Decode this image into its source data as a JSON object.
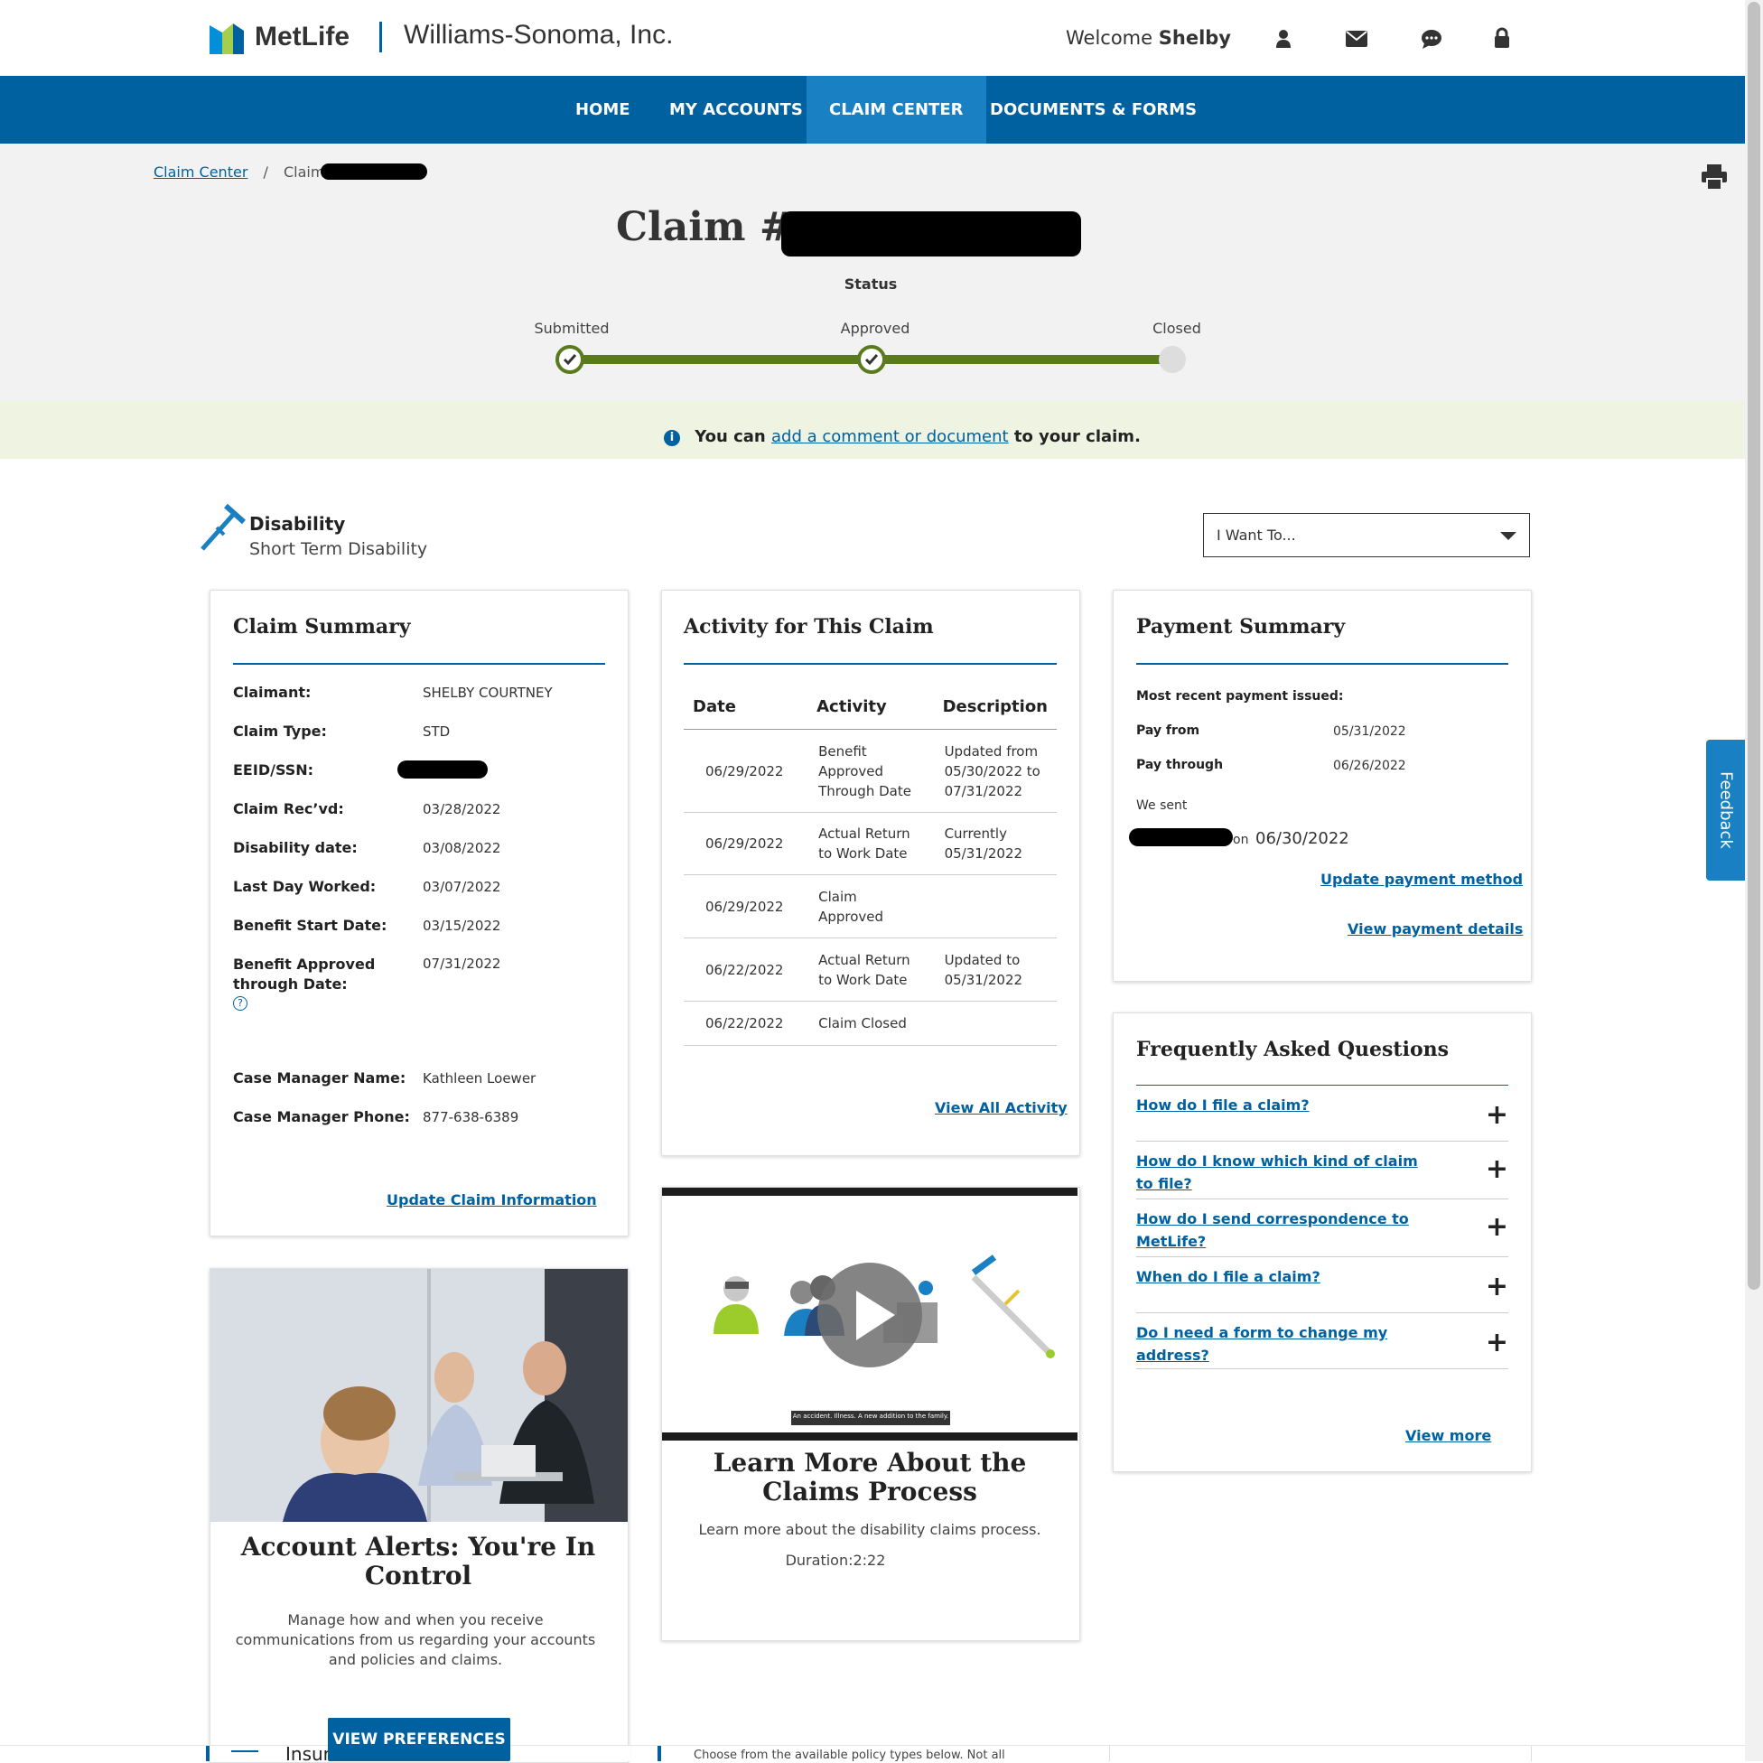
{
  "header": {
    "brand": "MetLife",
    "company": "Williams-Sonoma, Inc.",
    "welcome": "Welcome",
    "user": "Shelby",
    "icons": [
      "person-icon",
      "mail-icon",
      "chat-icon",
      "lock-icon"
    ]
  },
  "nav": {
    "items": [
      "HOME",
      "MY ACCOUNTS",
      "CLAIM CENTER",
      "DOCUMENTS & FORMS"
    ],
    "active": "CLAIM CENTER"
  },
  "breadcrumb": {
    "root": "Claim Center",
    "separator": "/",
    "current": "Claim"
  },
  "claim": {
    "title_prefix": "Claim #",
    "status_label": "Status",
    "steps": [
      {
        "label": "Submitted",
        "done": true
      },
      {
        "label": "Approved",
        "done": true
      },
      {
        "label": "Closed",
        "done": false
      }
    ]
  },
  "notice": {
    "before": "You can",
    "link": "add a comment or document",
    "after": "to your claim."
  },
  "disability": {
    "title": "Disability",
    "subtitle": "Short Term Disability"
  },
  "iwant": {
    "label": "I Want To..."
  },
  "claim_summary": {
    "title": "Claim Summary",
    "rows": [
      {
        "label": "Claimant:",
        "value": "SHELBY COURTNEY"
      },
      {
        "label": "Claim Type:",
        "value": "STD"
      },
      {
        "label": "EEID/SSN:",
        "value": ""
      },
      {
        "label": "Claim Rec’vd:",
        "value": "03/28/2022"
      },
      {
        "label": "Disability date:",
        "value": "03/08/2022"
      },
      {
        "label": "Last Day Worked:",
        "value": "03/07/2022"
      },
      {
        "label": "Benefit Start Date:",
        "value": "03/15/2022"
      },
      {
        "label": "Benefit Approved through Date:",
        "value": "07/31/2022"
      },
      {
        "label": "Case Manager Name:",
        "value": "Kathleen Loewer"
      },
      {
        "label": "Case Manager Phone:",
        "value": "877-638-6389"
      }
    ],
    "help_icon": "?",
    "update_link": "Update Claim Information"
  },
  "activity": {
    "title": "Activity for This Claim",
    "headers": [
      "Date",
      "Activity",
      "Description"
    ],
    "rows": [
      [
        "06/29/2022",
        "Benefit Approved Through Date",
        "Updated from 05/30/2022 to 07/31/2022"
      ],
      [
        "06/29/2022",
        "Actual Return to Work Date",
        "Currently 05/31/2022"
      ],
      [
        "06/29/2022",
        "Claim Approved",
        ""
      ],
      [
        "06/22/2022",
        "Actual Return to Work Date",
        "Updated to 05/31/2022"
      ],
      [
        "06/22/2022",
        "Claim Closed",
        ""
      ]
    ],
    "view_all": "View All Activity"
  },
  "payment": {
    "title": "Payment Summary",
    "recent": "Most recent payment issued:",
    "pay_from_label": "Pay from",
    "pay_from": "05/31/2022",
    "pay_through_label": "Pay through",
    "pay_through": "06/26/2022",
    "we_sent": "We sent",
    "on": "on",
    "sent_date": "06/30/2022",
    "update_link": "Update payment method",
    "details_link": "View payment details"
  },
  "faq": {
    "title": "Frequently Asked Questions",
    "items": [
      "How do I file a claim?",
      "How do I know which kind of claim to file?",
      "How do I send correspondence to MetLife?",
      "When do I file a claim?",
      "Do I need a form to change my address?"
    ],
    "view_more": "View more"
  },
  "alerts": {
    "title": "Account Alerts: You're In Control",
    "body": "Manage how and when you receive communications from us regarding your accounts and policies and claims.",
    "button": "VIEW PREFERENCES"
  },
  "video": {
    "caption": "An accident. Illness. A new addition to the family.",
    "title": "Learn More About the Claims Process",
    "body": "Learn more about the disability claims process.",
    "duration": "Duration:2:22"
  },
  "feedback": "Feedback",
  "bottom": {
    "insurance": "Insurance",
    "choose_text": "Choose from the available policy types below. Not all"
  },
  "colors": {
    "brand_blue": "#0061a0",
    "nav_active": "#1a80c4",
    "progress_green": "#5a7a1e",
    "notice_bg": "#eef3e2"
  }
}
